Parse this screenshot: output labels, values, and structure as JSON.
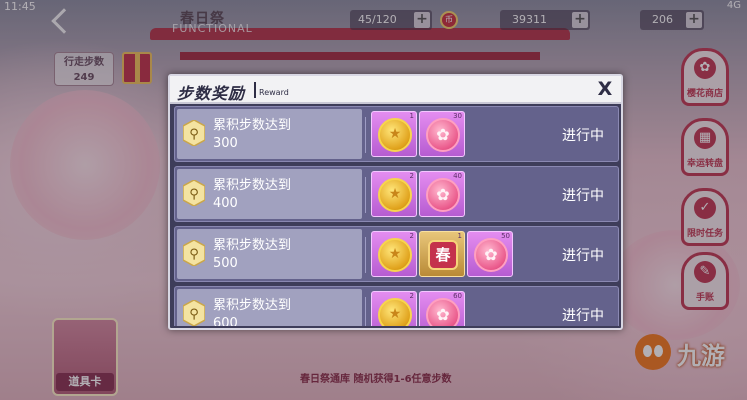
{
  "status_bar": {
    "time": "11:45",
    "network": "4G"
  },
  "topbar": {
    "event_title": "春日祭",
    "event_subtitle": "FUNCTIONAL",
    "resource_1": "45/120",
    "resource_2": "39311",
    "resource_3": "206",
    "coin_icon_label": "币"
  },
  "left_panel": {
    "steps_label": "行走步数",
    "steps_value": "249",
    "item_card_label": "道具卡"
  },
  "bottom_info": "春日祭通库 随机获得1-6任意步数",
  "right_menu": [
    {
      "label": "樱花商店",
      "icon": "flower-icon",
      "glyph": "✿"
    },
    {
      "label": "幸运转盘",
      "icon": "grid-icon",
      "glyph": "▦"
    },
    {
      "label": "限时任务",
      "icon": "check-icon",
      "glyph": "✓"
    },
    {
      "label": "手账",
      "icon": "book-icon",
      "glyph": "✎"
    }
  ],
  "watermark": "九游",
  "modal": {
    "title": "步数奖励",
    "subtitle": "Reward",
    "close_label": "X",
    "rows": [
      {
        "desc_line1": "累积步数达到",
        "desc_line2": "300",
        "status": "进行中",
        "rewards": [
          {
            "type": "gold-coin",
            "qty": "1"
          },
          {
            "type": "sakura-token",
            "qty": "30"
          }
        ]
      },
      {
        "desc_line1": "累积步数达到",
        "desc_line2": "400",
        "status": "进行中",
        "rewards": [
          {
            "type": "gold-coin",
            "qty": "2"
          },
          {
            "type": "sakura-token",
            "qty": "40"
          }
        ]
      },
      {
        "desc_line1": "累积步数达到",
        "desc_line2": "500",
        "status": "进行中",
        "rewards": [
          {
            "type": "gold-coin",
            "qty": "2"
          },
          {
            "type": "emblem",
            "qty": "1",
            "glyph": "春"
          },
          {
            "type": "sakura-token",
            "qty": "50"
          }
        ]
      },
      {
        "desc_line1": "累积步数达到",
        "desc_line2": "600",
        "status": "进行中",
        "rewards": [
          {
            "type": "gold-coin",
            "qty": "2"
          },
          {
            "type": "sakura-token",
            "qty": "60"
          }
        ]
      }
    ]
  },
  "colors": {
    "modal_bg": "#3e3d5a",
    "row_bg": "#64628c",
    "accent_red": "#c03a53"
  }
}
